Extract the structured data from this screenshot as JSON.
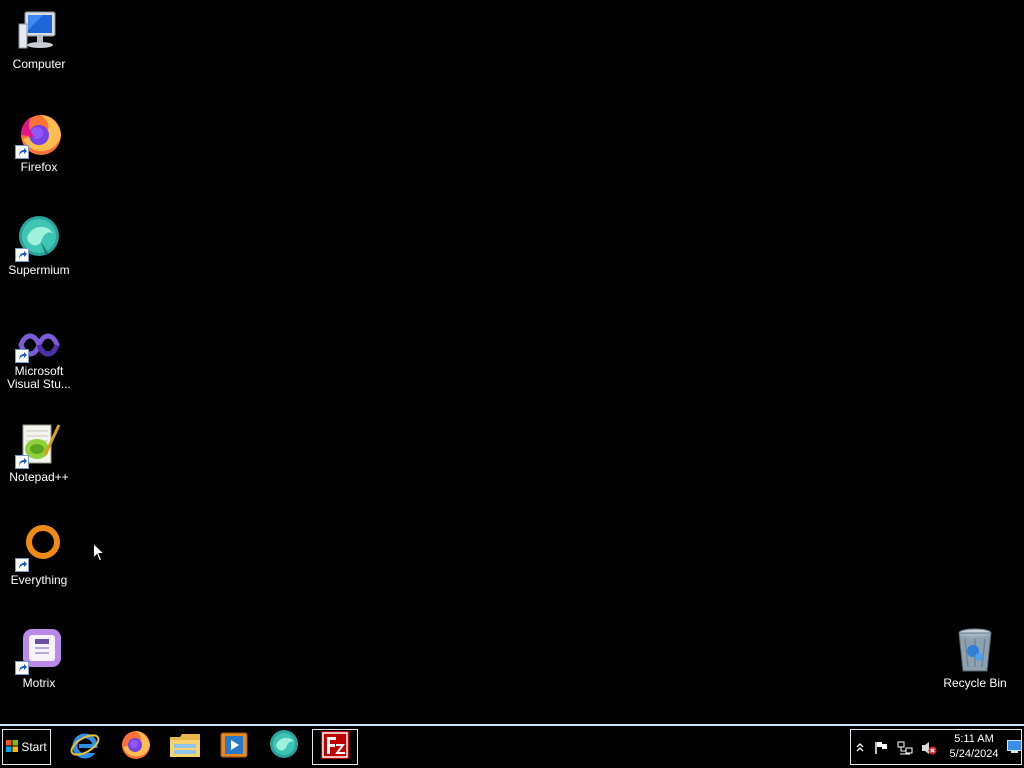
{
  "desktop": {
    "icons": [
      {
        "label": "Computer",
        "icon": "computer-icon"
      },
      {
        "label": "Firefox",
        "icon": "firefox-icon"
      },
      {
        "label": "Supermium",
        "icon": "supermium-icon"
      },
      {
        "label": "Microsoft Visual Stu...",
        "icon": "visual-studio-icon"
      },
      {
        "label": "Notepad++",
        "icon": "notepad-plus-plus-icon"
      },
      {
        "label": "Everything",
        "icon": "everything-icon"
      },
      {
        "label": "Motrix",
        "icon": "motrix-icon"
      },
      {
        "label": "Recycle Bin",
        "icon": "recycle-bin-icon"
      }
    ]
  },
  "taskbar": {
    "start_label": "Start",
    "pinned": [
      {
        "icon": "internet-explorer-icon"
      },
      {
        "icon": "firefox-icon"
      },
      {
        "icon": "file-explorer-icon"
      },
      {
        "icon": "media-player-icon"
      },
      {
        "icon": "supermium-icon"
      },
      {
        "icon": "filezilla-icon",
        "active": true
      }
    ],
    "tray": {
      "icons": [
        "show-hidden-icons-icon",
        "action-center-flag-icon",
        "network-icon",
        "volume-muted-icon"
      ],
      "time": "5:11 AM",
      "date": "5/24/2024"
    }
  },
  "colors": {
    "desktop_background": "#000000",
    "taskbar_border": "#cfe6f4",
    "filezilla_red": "#bf0000"
  }
}
